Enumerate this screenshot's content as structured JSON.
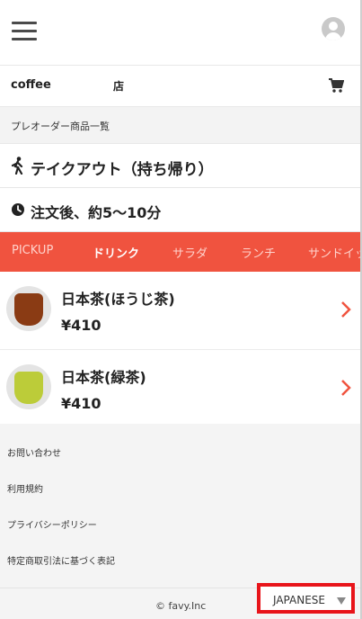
{
  "header": {
    "menu_icon": "hamburger-icon",
    "avatar_icon": "user-avatar-icon"
  },
  "shop": {
    "name": "coffee",
    "suffix": "店",
    "cart_icon": "cart-icon"
  },
  "section": {
    "title": "プレオーダー商品一覧"
  },
  "order_type": {
    "icon": "walking-person-icon",
    "label": "テイクアウト（持ち帰り）"
  },
  "wait_time": {
    "icon": "clock-icon",
    "label": "注文後、約5〜10分"
  },
  "tabs": [
    {
      "label": "PICKUP",
      "active": false
    },
    {
      "label": "ドリンク",
      "active": true
    },
    {
      "label": "サラダ",
      "active": false
    },
    {
      "label": "ランチ",
      "active": false
    },
    {
      "label": "サンドイッ",
      "active": false
    }
  ],
  "items": [
    {
      "name": "日本茶(ほうじ茶)",
      "price": "¥410",
      "tea_color": "#8a3b14"
    },
    {
      "name": "日本茶(緑茶)",
      "price": "¥410",
      "tea_color": "#bccc39"
    }
  ],
  "footer": {
    "links": [
      "お問い合わせ",
      "利用規約",
      "プライバシーポリシー",
      "特定商取引法に基づく表記"
    ],
    "copyright": "© favy.Inc",
    "language": "JAPANESE"
  },
  "colors": {
    "accent": "#f0533f",
    "highlight_border": "#e8141a"
  }
}
